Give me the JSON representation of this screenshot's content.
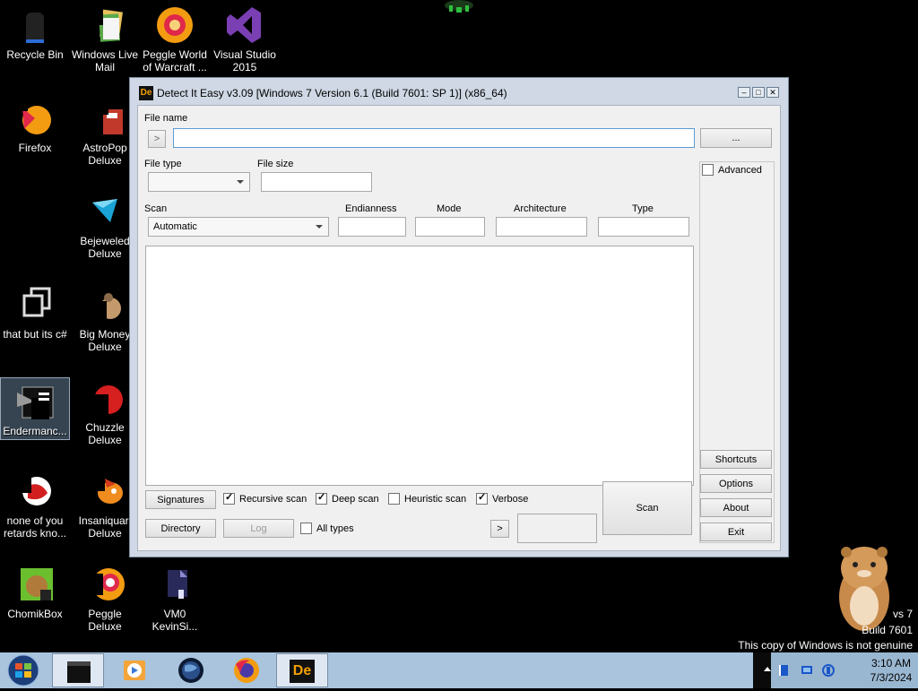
{
  "desktop": {
    "icons": [
      {
        "label": "Recycle Bin"
      },
      {
        "label": "Windows Live Mail"
      },
      {
        "label": "Peggle World of Warcraft ..."
      },
      {
        "label": "Visual Studio 2015"
      },
      {
        "label": "Firefox"
      },
      {
        "label": "AstroPop Deluxe"
      },
      {
        "label": "Bejeweled Deluxe"
      },
      {
        "label": "that but its c#"
      },
      {
        "label": "Big Money Deluxe"
      },
      {
        "label": "Endermanc..."
      },
      {
        "label": "Chuzzle Deluxe"
      },
      {
        "label": "none of you retards kno..."
      },
      {
        "label": "Insaniquar. Deluxe"
      },
      {
        "label": "ChomikBox"
      },
      {
        "label": "Peggle Deluxe"
      },
      {
        "label": "VM0 KevinSi..."
      }
    ],
    "watermark": {
      "line1": "vs 7",
      "line2": "Build 7601",
      "line3": "This copy of Windows is not genuine"
    }
  },
  "window": {
    "title": "Detect It Easy v3.09 [Windows 7 Version 6.1 (Build 7601: SP 1)] (x86_64)",
    "app_icon_text": "De",
    "file_name_label": "File name",
    "file_name_value": "",
    "open_arrow": ">",
    "browse_label": "...",
    "file_type_label": "File type",
    "file_size_label": "File size",
    "scan_label": "Scan",
    "scan_mode_value": "Automatic",
    "endianness_label": "Endianness",
    "mode_label": "Mode",
    "architecture_label": "Architecture",
    "type_label": "Type",
    "advanced_label": "Advanced",
    "advanced_checked": false,
    "buttons": {
      "signatures": "Signatures",
      "directory": "Directory",
      "log": "Log",
      "next_arrow": ">",
      "scan": "Scan",
      "shortcuts": "Shortcuts",
      "options": "Options",
      "about": "About",
      "exit": "Exit"
    },
    "checkboxes": {
      "recursive_scan": {
        "label": "Recursive scan",
        "checked": true
      },
      "deep_scan": {
        "label": "Deep scan",
        "checked": true
      },
      "heuristic_scan": {
        "label": "Heuristic scan",
        "checked": false
      },
      "verbose": {
        "label": "Verbose",
        "checked": true
      },
      "all_types": {
        "label": "All types",
        "checked": false
      }
    }
  },
  "taskbar": {
    "clock_time": "3:10 AM",
    "clock_date": "7/3/2024",
    "app_icon_text": "De"
  },
  "colors": {
    "window_frame": "#cfd8e4",
    "taskbar": "#a9c4dc",
    "focus_border": "#5b9bd5"
  }
}
